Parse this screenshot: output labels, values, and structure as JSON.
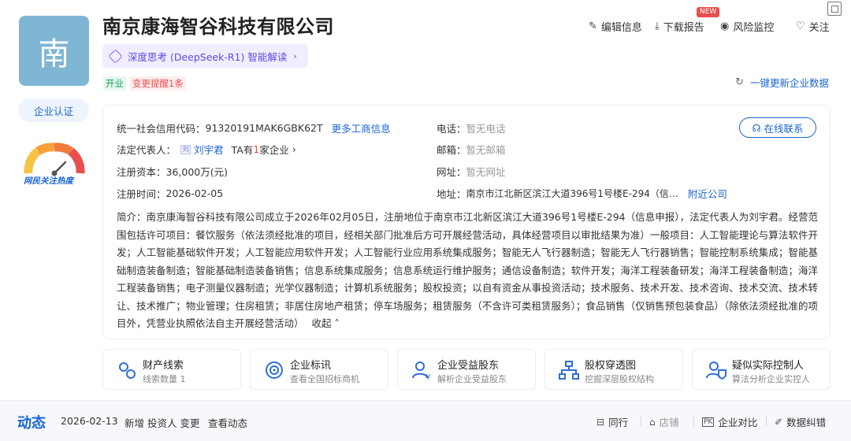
{
  "company": {
    "logo_char": "南",
    "name": "南京康海智谷科技有限公司",
    "ai_interpret": "深度思考 (DeepSeek-R1) 智能解读",
    "status_tag": "开业",
    "change_tag": "变更提醒1条",
    "cert_button": "企业认证",
    "heat_label": "网民关注热度"
  },
  "actions": {
    "edit": "编辑信息",
    "download": "下载报告",
    "new_badge": "NEW",
    "risk": "风险监控",
    "follow": "关注",
    "update": "一键更新企业数据"
  },
  "info": {
    "credit_code_label": "统一社会信用代码：",
    "credit_code": "91320191MAK6GBK62T",
    "more_business": "更多工商信息",
    "phone_label": "电话：",
    "phone": "暂无电话",
    "online_contact": "在线联系",
    "legal_rep_label": "法定代表人：",
    "legal_rep_icon": "刘",
    "legal_rep": "刘宇君",
    "ta_prefix": "TA有",
    "ta_count": "1",
    "ta_suffix": "家企业",
    "email_label": "邮箱：",
    "email": "暂无邮箱",
    "capital_label": "注册资本：",
    "capital": "36,000万(元)",
    "website_label": "网址：",
    "website": "暂无网址",
    "reg_time_label": "注册时间：",
    "reg_time": "2026-02-05",
    "address_label": "地址：",
    "address": "南京市江北新区滨江大道396号1号楼E-294（信…",
    "nearby": "附近公司",
    "intro_label": "简介：",
    "intro": "南京康海智谷科技有限公司成立于2026年02月05日，注册地位于南京市江北新区滨江大道396号1号楼E-294（信息申报），法定代表人为刘宇君。经营范围包括许可项目：餐饮服务（依法须经批准的项目，经相关部门批准后方可开展经营活动，具体经营项目以审批结果为准）一般项目：人工智能理论与算法软件开发；人工智能基础软件开发；人工智能应用软件开发；人工智能行业应用系统集成服务；智能无人飞行器制造；智能无人飞行器销售；智能控制系统集成；智能基础制造装备制造；智能基础制造装备销售；信息系统集成服务；信息系统运行维护服务；通信设备制造；软件开发；海洋工程装备研发；海洋工程装备制造；海洋工程装备销售；电子测量仪器制造；光学仪器制造；计算机系统服务；股权投资；以自有资金从事投资活动；技术服务、技术开发、技术咨询、技术交流、技术转让、技术推广；物业管理；住房租赁；非居住房地产租赁；停车场服务；租赁服务（不含许可类租赁服务）；食品销售（仅销售预包装食品）（除依法须经批准的项目外，凭营业执照依法自主开展经营活动）",
    "collapse": "收起"
  },
  "features": [
    {
      "title": "财产线索",
      "sub": "线索数量 1",
      "icon": "property-icon"
    },
    {
      "title": "企业标讯",
      "sub": "查看全国招标商机",
      "icon": "target-icon"
    },
    {
      "title": "企业受益股东",
      "sub": "解析企业受益股东",
      "icon": "beneficiary-icon"
    },
    {
      "title": "股权穿透图",
      "sub": "挖掘深层股权结构",
      "icon": "equity-tree-icon"
    },
    {
      "title": "疑似实际控制人",
      "sub": "算法分析企业实控人",
      "icon": "controller-icon"
    }
  ],
  "dynamics": {
    "title": "动态",
    "date": "2026-02-13",
    "text": "新增 投资人 变更",
    "link": "查看动态"
  },
  "bottom_actions": {
    "peers": "同行",
    "stores": "店铺",
    "compare": "企业对比",
    "correction": "数据纠错"
  }
}
